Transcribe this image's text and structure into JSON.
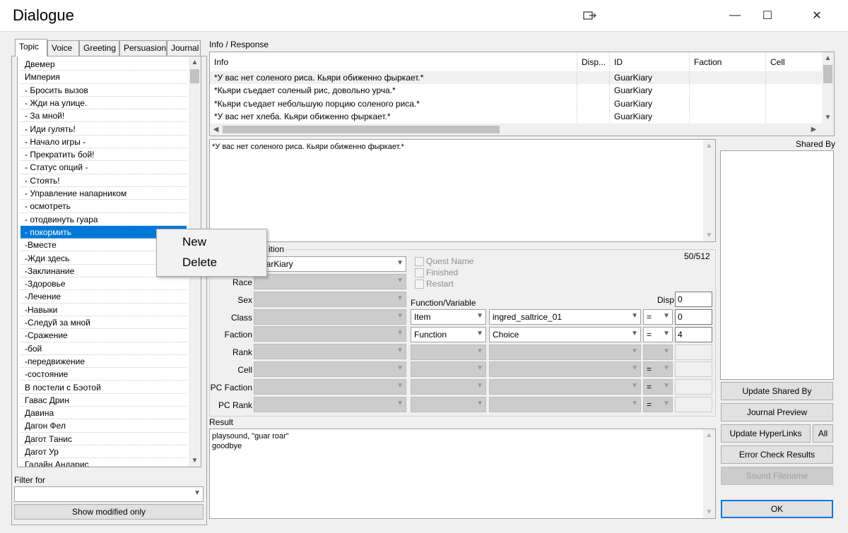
{
  "window": {
    "title": "Dialogue",
    "buttons": {
      "restore_icon": "window-restore-icon",
      "minimize": "—",
      "maximize": "☐",
      "close": "✕"
    }
  },
  "left_panel": {
    "tabs": [
      "Topic",
      "Voice",
      "Greeting",
      "Persuasion",
      "Journal"
    ],
    "active_tab": "Topic",
    "topics": [
      "Двемер",
      "Империя",
      "- Бросить вызов",
      "- Жди на улице.",
      "- За мной!",
      "- Иди гулять!",
      "- Начало игры -",
      "- Прекратить бой!",
      "- Статус опций -",
      "- Стоять!",
      "- Управление напарником",
      "- осмотреть",
      "- отодвинуть гуара",
      "- покормить",
      "-Вместе",
      "-Жди здесь",
      "-Заклинание",
      "-Здоровье",
      "-Лечение",
      "-Навыки",
      "-Следуй за мной",
      "-Сражение",
      "-бой",
      "-передвижение",
      "-состояние",
      "В постели с Бэотой",
      "Гавас Дрин",
      "Давина",
      "Дагон Фел",
      "Дагот Танис",
      "Дагот Ур",
      "Галайн Андарис"
    ],
    "selected_topic": "- покормить",
    "filter_label": "Filter for",
    "filter_value": "",
    "show_modified_label": "Show modified only"
  },
  "context_menu": {
    "items": [
      "New",
      "Delete"
    ]
  },
  "info_response": {
    "group_label": "Info / Response",
    "columns": [
      "Info",
      "Disp...",
      "ID",
      "Faction",
      "Cell"
    ],
    "rows": [
      {
        "info": "*У вас нет соленого риса. Кьяри обиженно фыркает.*",
        "disp": "",
        "id": "GuarKiary",
        "faction": "",
        "cell": ""
      },
      {
        "info": "*Кьяри съедает соленый рис, довольно урча.*",
        "disp": "",
        "id": "GuarKiary",
        "faction": "",
        "cell": ""
      },
      {
        "info": "*Кьяри съедает небольшую порцию соленого риса.*",
        "disp": "",
        "id": "GuarKiary",
        "faction": "",
        "cell": ""
      },
      {
        "info": "*У вас нет хлеба. Кьяри обиженно фыркает.*",
        "disp": "",
        "id": "GuarKiary",
        "faction": "",
        "cell": ""
      }
    ],
    "response_text": "*У вас нет соленого риса. Кьяри обиженно фыркает.*"
  },
  "shared_by": {
    "label": "Shared By"
  },
  "conditions": {
    "group_label_visible": "ition",
    "char_count": "50/512",
    "id_value": "uarKiary",
    "rows": [
      {
        "label": "Race",
        "value": ""
      },
      {
        "label": "Sex",
        "value": ""
      },
      {
        "label": "Class",
        "value": ""
      },
      {
        "label": "Faction",
        "value": ""
      },
      {
        "label": "Rank",
        "value": ""
      },
      {
        "label": "Cell",
        "value": ""
      },
      {
        "label": "PC Faction",
        "value": ""
      },
      {
        "label": "PC Rank",
        "value": ""
      }
    ],
    "checkboxes": [
      "Quest Name",
      "Finished",
      "Restart"
    ],
    "function_variable_label": "Function/Variable",
    "disp_label": "Disp",
    "disp_value": "0",
    "func_rows": [
      {
        "type": "Item",
        "name": "ingred_saltrice_01",
        "op": "=",
        "value": "0"
      },
      {
        "type": "Function",
        "name": "Choice",
        "op": "=",
        "value": "4"
      },
      {
        "type": "",
        "name": "",
        "op": "",
        "value": ""
      },
      {
        "type": "",
        "name": "",
        "op": "=",
        "value": ""
      },
      {
        "type": "",
        "name": "",
        "op": "=",
        "value": ""
      },
      {
        "type": "",
        "name": "",
        "op": "=",
        "value": ""
      }
    ]
  },
  "result": {
    "label": "Result",
    "lines": [
      "playsound, \"guar roar\"",
      "goodbye"
    ]
  },
  "right_buttons": {
    "update_shared_by": "Update Shared By",
    "journal_preview": "Journal Preview",
    "update_hyperlinks": "Update HyperLinks",
    "all": "All",
    "error_check": "Error Check Results",
    "sound_filename": "Sound Filename",
    "ok": "OK"
  }
}
